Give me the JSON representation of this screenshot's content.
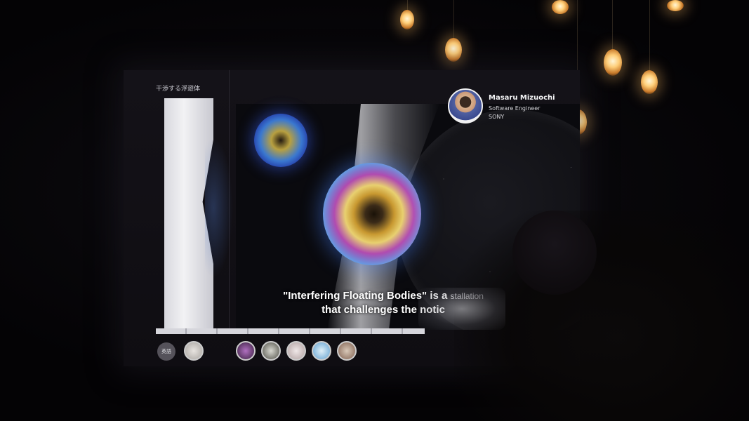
{
  "slide": {
    "title_jp": "干渉する浮遊体",
    "subtitle_line1": "\"Interfering Floating Bodies\" is a",
    "subtitle_line2": "that challenges the notic",
    "subtitle_fragment": "stallation"
  },
  "speaker": {
    "name": "Masaru  Mizuochi",
    "role": "Software  Engineer",
    "org": "SONY"
  },
  "participants": {
    "badge_label": "英語"
  },
  "colors": {
    "bulb": "#ffcf7a",
    "screen_bg": "#141218",
    "orb_blue": "#3a78d0",
    "orb_gold": "#e8d070",
    "subtitle_text": "#ffffff"
  },
  "icons": [
    "hanging-bulb-icon",
    "speaker-avatar",
    "participant-avatar"
  ]
}
